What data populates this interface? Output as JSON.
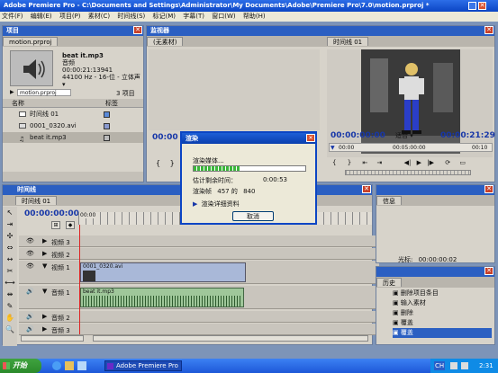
{
  "window": {
    "title": "Adobe Premiere Pro - C:\\Documents and Settings\\Administrator\\My Documents\\Adobe\\Premiere Pro\\7.0\\motion.prproj *"
  },
  "menu": [
    "文件(F)",
    "编辑(E)",
    "项目(P)",
    "素材(C)",
    "时间线(S)",
    "标记(M)",
    "字幕(T)",
    "窗口(W)",
    "帮助(H)"
  ],
  "project": {
    "panel_title": "项目",
    "tab": "motion.prproj",
    "clip_name": "beat it.mp3",
    "clip_type": "音频",
    "clip_duration": "00:00:21:13941",
    "clip_format": "44100 Hz - 16-位 - 立体声 ▾",
    "bin_name": "motion.prproj",
    "item_count": "3 项目",
    "col_name": "名称",
    "col_label": "标签",
    "items": [
      {
        "name": "时间线 01"
      },
      {
        "name": "0001_0320.avi"
      },
      {
        "name": "beat it.mp3"
      }
    ]
  },
  "monitor": {
    "panel_title": "监视器",
    "source_tab": "(无素材)",
    "source_time": "00:00",
    "program_tab": "时间线 01",
    "program_time": "00:00:00:00",
    "fit": "适合",
    "program_duration": "00:00:21:29",
    "ruler": [
      "00:00",
      "00:05:00:00",
      "00:10"
    ]
  },
  "render": {
    "title": "渲染",
    "status": "渲染媒体...",
    "progress": 0.42,
    "remaining_label": "估计剩余时间：",
    "remaining_value": "0:00:53",
    "frame_label": "渲染帧",
    "frame_current": "457",
    "frame_of": "的",
    "frame_total": "840",
    "details": "渲染详细资料",
    "cancel": "取消"
  },
  "timeline": {
    "panel_title": "时间线",
    "tab": "时间线 01",
    "timecode": "00:00:00:00",
    "ruler_start": "00:00",
    "tracks": [
      {
        "name": "视频 3"
      },
      {
        "name": "视频 2"
      },
      {
        "name": "视频 1",
        "clip": "0001_0320.avi"
      },
      {
        "name": "音频 1",
        "clip": "beat it.mp3"
      },
      {
        "name": "音频 2"
      },
      {
        "name": "音频 3"
      }
    ]
  },
  "info": {
    "tab": "信息",
    "cursor_label": "光标:",
    "cursor_value": "00:00:00:02"
  },
  "history": {
    "tab": "历史",
    "items": [
      "删除项目条目",
      "输入素材",
      "删除",
      "覆盖",
      "覆盖"
    ]
  },
  "taskbar": {
    "start": "开始",
    "task": "Adobe Premiere Pro",
    "lang": "CH",
    "clock": "2:31"
  }
}
